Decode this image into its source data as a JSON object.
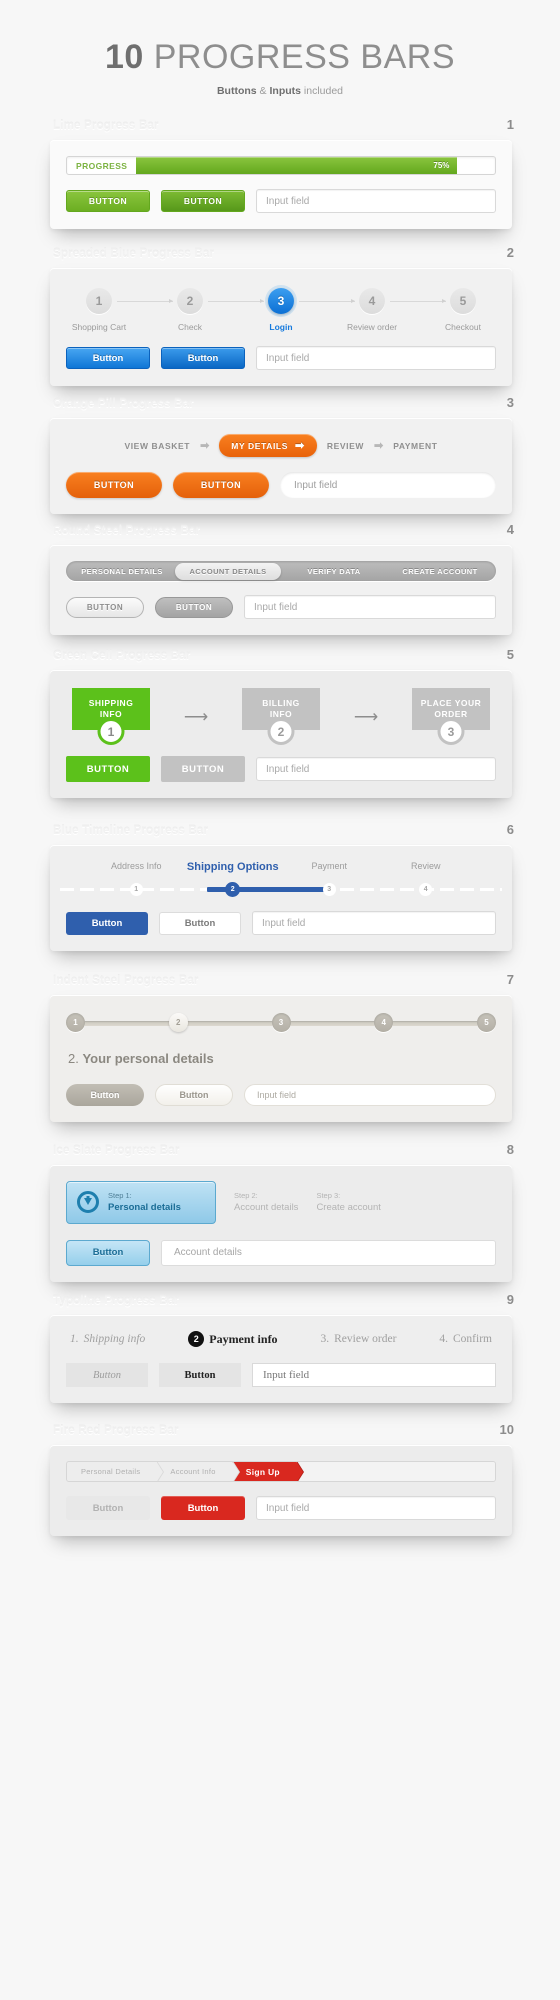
{
  "hero": {
    "number": "10",
    "title": " PROGRESS BARS",
    "sub_bold_1": "Buttons",
    "sub_amp": " & ",
    "sub_bold_2": "Inputs",
    "sub_tail": " included"
  },
  "common": {
    "input_placeholder": "Input field"
  },
  "sections": [
    {
      "num": "1",
      "title": "Lime Progress Bar",
      "progress_label": "PROGRESS",
      "progress_value": "75%",
      "progress_pct": 75,
      "btn1": "BUTTON",
      "btn2": "BUTTON",
      "input": "Input field"
    },
    {
      "num": "2",
      "title": "Spreaded Blue Progress Bar",
      "steps": [
        {
          "n": "1",
          "label": "Shopping Cart",
          "active": false
        },
        {
          "n": "2",
          "label": "Check",
          "active": false
        },
        {
          "n": "3",
          "label": "Login",
          "active": true
        },
        {
          "n": "4",
          "label": "Review order",
          "active": false
        },
        {
          "n": "5",
          "label": "Checkout",
          "active": false
        }
      ],
      "btn1": "Button",
      "btn2": "Button",
      "input": "Input field"
    },
    {
      "num": "3",
      "title": "Orange Pill Progress Bar",
      "steps": [
        {
          "label": "VIEW BASKET",
          "active": false
        },
        {
          "label": "MY DETAILS",
          "active": true
        },
        {
          "label": "REVIEW",
          "active": false
        },
        {
          "label": "PAYMENT",
          "active": false
        }
      ],
      "arrow": "➡",
      "btn1": "BUTTON",
      "btn2": "BUTTON",
      "input": "Input field"
    },
    {
      "num": "4",
      "title": "Round Steel Progress Bar",
      "steps": [
        {
          "label": "PERSONAL DETAILS",
          "active": false
        },
        {
          "label": "ACCOUNT DETAILS",
          "active": true
        },
        {
          "label": "VERIFY DATA",
          "active": false
        },
        {
          "label": "CREATE ACCOUNT",
          "active": false
        }
      ],
      "btn1": "BUTTON",
      "btn2": "BUTTON",
      "input": "Input field"
    },
    {
      "num": "5",
      "title": "Green Cell Progress Bar",
      "steps": [
        {
          "line1": "SHIPPING",
          "line2": "INFO",
          "n": "1",
          "active": true
        },
        {
          "line1": "BILLING",
          "line2": "INFO",
          "n": "2",
          "active": false
        },
        {
          "line1": "PLACE YOUR",
          "line2": "ORDER",
          "n": "3",
          "active": false
        }
      ],
      "btn1": "BUTTON",
      "btn2": "BUTTON",
      "input": "Input field"
    },
    {
      "num": "6",
      "title": "Blue Timeline Progress Bar",
      "steps": [
        {
          "n": "1",
          "label": "Address Info",
          "active": false
        },
        {
          "n": "2",
          "label": "Shipping Options",
          "active": true
        },
        {
          "n": "3",
          "label": "Payment",
          "active": false
        },
        {
          "n": "4",
          "label": "Review",
          "active": false
        }
      ],
      "btn1": "Button",
      "btn2": "Button",
      "input": "Input field"
    },
    {
      "num": "7",
      "title": "Indent Steel Progress Bar",
      "steps": [
        {
          "n": "1",
          "active": false
        },
        {
          "n": "2",
          "active": true
        },
        {
          "n": "3",
          "active": false
        },
        {
          "n": "4",
          "active": false
        },
        {
          "n": "5",
          "active": false
        }
      ],
      "heading_num": "2. ",
      "heading_text": "Your personal details",
      "btn1": "Button",
      "btn2": "Button",
      "input": "Input field"
    },
    {
      "num": "8",
      "title": "Ice Slate Progress Bar",
      "steps": [
        {
          "kicker": "Step 1:",
          "label": "Personal details",
          "active": true
        },
        {
          "kicker": "Step 2:",
          "label": "Account details",
          "active": false
        },
        {
          "kicker": "Step 3:",
          "label": "Create account",
          "active": false
        }
      ],
      "btn1": "Button",
      "input": "Account details"
    },
    {
      "num": "9",
      "title": "Typoline Progress Bar",
      "steps": [
        {
          "n": "1.",
          "label": "Shipping info",
          "active": false
        },
        {
          "n": "2",
          "label": "Payment info",
          "active": true
        },
        {
          "n": "3.",
          "label": "Review order",
          "active": false
        },
        {
          "n": "4.",
          "label": "Confirm",
          "active": false
        }
      ],
      "btn1": "Button",
      "btn2": "Button",
      "input": "Input field"
    },
    {
      "num": "10",
      "title": "Fire Red Progress Bar",
      "steps": [
        {
          "label": "Personal Details",
          "active": false
        },
        {
          "label": "Account Info",
          "active": false
        },
        {
          "label": "Sign Up",
          "active": true
        }
      ],
      "btn1": "Button",
      "btn2": "Button",
      "input": "Input field"
    }
  ],
  "colors": {
    "lime": "#6cae22",
    "blue": "#0f76d6",
    "orange": "#e8620a",
    "steel": "#b4b4b4",
    "green": "#5cc11b",
    "timeline_blue": "#2f5fad",
    "indent": "#b4b0a6",
    "ice": "#1b6d96",
    "typo": "#111111",
    "fire": "#d9281f"
  }
}
